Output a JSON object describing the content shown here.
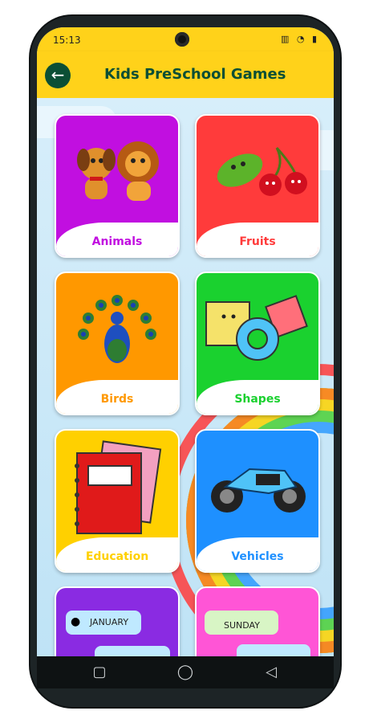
{
  "status_bar": {
    "time": "15:13",
    "icons": "▥ ◔ ▮"
  },
  "app_bar": {
    "title": "Kids PreSchool Games",
    "back_icon": "arrow-left-icon"
  },
  "colors": {
    "header": "#ffd21a",
    "title": "#0b4f35",
    "animals": "#c10fe0",
    "fruits": "#ff3b3b",
    "birds": "#ff9800",
    "shapes": "#1ad12f",
    "education": "#ffd000",
    "vehicles": "#1e90ff",
    "calendar": "#8a2be2",
    "days": "#ff55d6"
  },
  "cards": [
    {
      "label": "Animals",
      "icon": "animals-icon"
    },
    {
      "label": "Fruits",
      "icon": "fruits-icon"
    },
    {
      "label": "Birds",
      "icon": "peacock-icon"
    },
    {
      "label": "Shapes",
      "icon": "shapes-icon"
    },
    {
      "label": "Education",
      "icon": "notebook-icon"
    },
    {
      "label": "Vehicles",
      "icon": "motorbike-icon"
    },
    {
      "label": "",
      "month": "JANUARY",
      "icon": "calendar-icon"
    },
    {
      "label": "",
      "day": "SUNDAY",
      "icon": "days-icon"
    }
  ],
  "nav": {
    "recent": "▢",
    "home": "◯",
    "back": "◁"
  }
}
